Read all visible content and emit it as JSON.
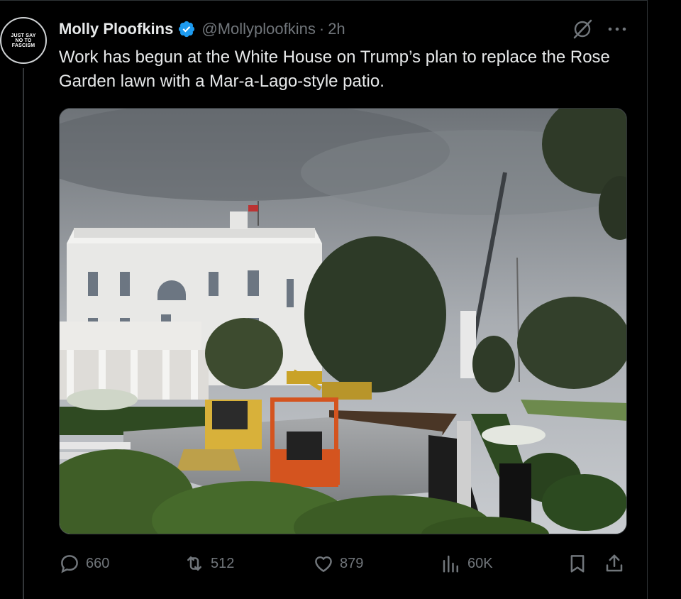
{
  "post": {
    "avatar_text": "JUST SAY NO TO FASCISM",
    "author_name": "Molly Ploofkins",
    "handle": "@Mollyploofkins",
    "separator": "·",
    "time": "2h",
    "text": "Work has begun at the White House on Trump’s plan to replace the Rose Garden lawn with a Mar-a-Lago-style patio.",
    "verified_color": "#1d9bf0"
  },
  "actions": {
    "replies": "660",
    "reposts": "512",
    "likes": "879",
    "views": "60K"
  },
  "icons": {
    "more": "more-horizontal-icon",
    "grok": "grok-icon",
    "reply": "reply-icon",
    "repost": "repost-icon",
    "like": "heart-icon",
    "views": "views-chart-icon",
    "bookmark": "bookmark-icon",
    "share": "share-icon"
  }
}
